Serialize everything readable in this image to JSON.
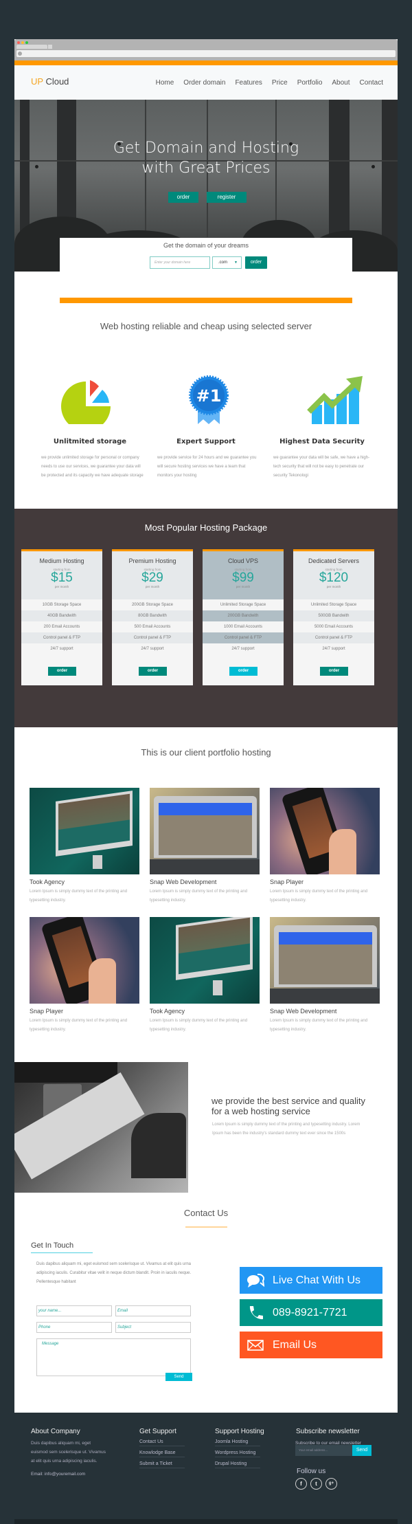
{
  "browser": {
    "dots": [
      "#ff5f57",
      "#ffbd2e",
      "#28c940"
    ]
  },
  "nav": {
    "logo_accent": "UP",
    "logo_rest": " Cloud",
    "links": [
      "Home",
      "Order domain",
      "Features",
      "Price",
      "Portfolio",
      "About",
      "Contact"
    ]
  },
  "hero": {
    "title_line1": "Get Domain and Hosting",
    "title_line2": "with Great Prices",
    "order_label": "order",
    "register_label": "register"
  },
  "domain": {
    "title": "Get the domain of your dreams",
    "placeholder": "Enter your domain here",
    "tld_selected": ".com",
    "order_label": "order"
  },
  "features": {
    "title": "Web hosting reliable and cheap using selected server",
    "items": [
      {
        "icon": "pie-chart-icon",
        "heading": "Unlitmited storage",
        "text": "we provide unlimited storage for personal or company needs to use our services, we guarantee your data will be protected and its capacity we have adequate storage"
      },
      {
        "icon": "badge-number-one-icon",
        "heading": "Expert Support",
        "text": "we provide service for 24 hours and we guarantee you will secure hosting services we have a team that monitors your hosting"
      },
      {
        "icon": "growth-chart-icon",
        "heading": "Highest Data Security",
        "text": "we guarantee your data will be safe, we have a high-tech security that will not be easy to penetrate our security Tekonologi"
      }
    ]
  },
  "pricing": {
    "title": "Most Popular Hosting Package",
    "starting_from": "starting from",
    "per_month": "per month",
    "order_label": "order",
    "plans": [
      {
        "name": "Medium Hosting",
        "price": "$15",
        "features": [
          "10GB Storage Space",
          "40GB Bandwith",
          "200 Email Accounts",
          "Control panel & FTP",
          "24/7 support"
        ],
        "highlighted": false
      },
      {
        "name": "Premium Hosting",
        "price": "$29",
        "features": [
          "200GB Storage Space",
          "80GB Bandwith",
          "500 Email Accounts",
          "Control panel & FTP",
          "24/7 support"
        ],
        "highlighted": false
      },
      {
        "name": "Cloud VPS",
        "price": "$99",
        "features": [
          "Unlimited Storage Space",
          "200GB Bandwith",
          "1000 Email Accounts",
          "Control panel & FTP",
          "24/7 support"
        ],
        "highlighted": true
      },
      {
        "name": "Dedicated Servers",
        "price": "$120",
        "features": [
          "Unlimited Storage Space",
          "500GB Bandwith",
          "5000 Email Accounts",
          "Control panel & FTP",
          "24/7 support"
        ],
        "highlighted": false
      }
    ]
  },
  "portfolio": {
    "title": "This is our client portfolio hosting",
    "items": [
      {
        "name": "Took Agency",
        "desc": "Lorem Ipsum is simply dummy text of the printing and typesetting industry.",
        "image": "imac-mockup"
      },
      {
        "name": "Snap Web Development",
        "desc": "Lorem Ipsum is simply dummy text of the printing and typesetting industry.",
        "image": "laptop-mockup"
      },
      {
        "name": "Snap Player",
        "desc": "Lorem Ipsum is simply dummy text of the printing and typesetting industry.",
        "image": "phone-mockup"
      },
      {
        "name": "Snap Player",
        "desc": "Lorem Ipsum is simply dummy text of the printing and typesetting industry.",
        "image": "phone-mockup"
      },
      {
        "name": "Took Agency",
        "desc": "Lorem Ipsum is simply dummy text of the printing and typesetting industry.",
        "image": "imac-mockup"
      },
      {
        "name": "Snap Web Development",
        "desc": "Lorem Ipsum is simply dummy text of the printing and typesetting industry.",
        "image": "laptop-mockup"
      }
    ]
  },
  "service": {
    "title": "we provide the best service and quality for a web hosting service",
    "text": "Lorem Ipsum is simply dummy text of the printing and typesetting industry. Lorem Ipsum has been the industry's standard dummy text ever since the 1500s"
  },
  "contact": {
    "title": "Contact Us",
    "get_in_touch": "Get In Touch",
    "text": "Duis dapibus aliquam mi, eget euismod sem scelerisque ut. Vivamus at elit quis urna adipiscing iaculis. Curabitur vitae velit in neque dictum blandit. Proin in iaculis neque. Pellentesque habitant",
    "fields": {
      "name": "your name...",
      "email": "Email",
      "phone": "Phone",
      "subject": "Subject",
      "message": "Message"
    },
    "send_label": "Send",
    "ctas": [
      {
        "label": "Live Chat With Us",
        "icon": "chat-bubbles-icon",
        "color": "#2196f3"
      },
      {
        "label": "089-8921-7721",
        "icon": "phone-icon",
        "color": "#009688"
      },
      {
        "label": "Email Us",
        "icon": "envelope-icon",
        "color": "#ff5722"
      }
    ]
  },
  "footer": {
    "about_title": "About Company",
    "about_text": "Duis dapibus aliquam mi, eget euismod sem scelerisque ut.  Vivamus at elit quis urna adipiscing iaculis.",
    "email": "Email: info@youremail.com",
    "support_title": "Get Support",
    "support_links": [
      "Contact Us",
      "Knowlodge Base",
      "Submit a Ticket"
    ],
    "hosting_title": "Support Hosting",
    "hosting_links": [
      "Joomla Hosting",
      "Wordpress Hosting",
      "Drupal Hosting"
    ],
    "newsletter_title": "Subscribe newsletter",
    "newsletter_text": "Subscribe to our email newsletter",
    "newsletter_placeholder": "Your email address...",
    "newsletter_send": "Send",
    "follow_title": "Follow us",
    "social": [
      {
        "icon": "facebook-icon",
        "glyph": "f"
      },
      {
        "icon": "twitter-icon",
        "glyph": "t"
      },
      {
        "icon": "google-plus-icon",
        "glyph": "g+"
      }
    ]
  },
  "colors": {
    "accent_orange": "#ff9800",
    "teal": "#00897b",
    "cyan": "#00bcd4",
    "page_bg": "#263238",
    "pricing_bg": "#433a3b"
  }
}
